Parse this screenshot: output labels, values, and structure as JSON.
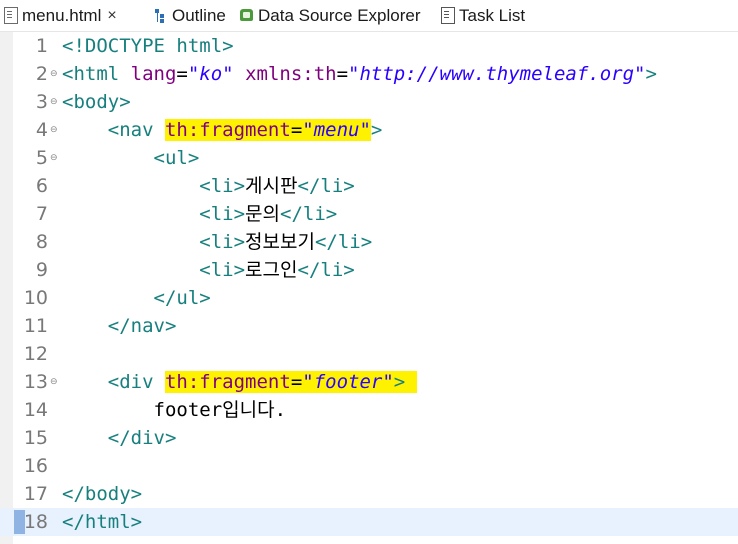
{
  "tabs": [
    {
      "label": "menu.html",
      "icon": "html-file-icon",
      "closable": true,
      "active": true
    },
    {
      "label": "Outline",
      "icon": "outline-icon"
    },
    {
      "label": "Data Source Explorer",
      "icon": "data-source-icon"
    },
    {
      "label": "Task List",
      "icon": "task-list-icon"
    }
  ],
  "close_glyph": "×",
  "editor": {
    "current_line": 18,
    "colors": {
      "tag": "#17807e",
      "attribute": "#7f007f",
      "string": "#2a00ff",
      "highlight": "#fff200",
      "current_line": "#e8f2fe"
    },
    "lines": [
      {
        "n": "1",
        "fold": "",
        "parts": [
          {
            "c": "tag",
            "t": "<!DOCTYPE html>"
          }
        ]
      },
      {
        "n": "2",
        "fold": "⊖",
        "parts": [
          {
            "c": "tag",
            "t": "<html "
          },
          {
            "c": "attr",
            "t": "lang"
          },
          {
            "c": "text",
            "t": "="
          },
          {
            "c": "str",
            "t": "\"ko\""
          },
          {
            "c": "text",
            "t": " "
          },
          {
            "c": "attr",
            "t": "xmlns:th"
          },
          {
            "c": "text",
            "t": "="
          },
          {
            "c": "str",
            "t": "\"http://www.thymeleaf.org\""
          },
          {
            "c": "tag",
            "t": ">"
          }
        ]
      },
      {
        "n": "3",
        "fold": "⊖",
        "parts": [
          {
            "c": "tag",
            "t": "<body>"
          }
        ]
      },
      {
        "n": "4",
        "fold": "⊖",
        "parts": [
          {
            "c": "text",
            "t": "    "
          },
          {
            "c": "tag",
            "t": "<nav"
          },
          {
            "c": "text",
            "t": " "
          },
          {
            "c": "attr",
            "t": "th:fragment",
            "hl": true
          },
          {
            "c": "text",
            "t": "=",
            "hl": true
          },
          {
            "c": "str",
            "t": "\"menu\"",
            "hl": true
          },
          {
            "c": "tag",
            "t": ">"
          }
        ]
      },
      {
        "n": "5",
        "fold": "⊖",
        "parts": [
          {
            "c": "text",
            "t": "        "
          },
          {
            "c": "tag",
            "t": "<ul>"
          }
        ]
      },
      {
        "n": "6",
        "fold": "",
        "parts": [
          {
            "c": "text",
            "t": "            "
          },
          {
            "c": "tag",
            "t": "<li>"
          },
          {
            "c": "text",
            "t": "게시판"
          },
          {
            "c": "tag",
            "t": "</li>"
          }
        ]
      },
      {
        "n": "7",
        "fold": "",
        "parts": [
          {
            "c": "text",
            "t": "            "
          },
          {
            "c": "tag",
            "t": "<li>"
          },
          {
            "c": "text",
            "t": "문의"
          },
          {
            "c": "tag",
            "t": "</li>"
          }
        ]
      },
      {
        "n": "8",
        "fold": "",
        "parts": [
          {
            "c": "text",
            "t": "            "
          },
          {
            "c": "tag",
            "t": "<li>"
          },
          {
            "c": "text",
            "t": "정보보기"
          },
          {
            "c": "tag",
            "t": "</li>"
          }
        ]
      },
      {
        "n": "9",
        "fold": "",
        "parts": [
          {
            "c": "text",
            "t": "            "
          },
          {
            "c": "tag",
            "t": "<li>"
          },
          {
            "c": "text",
            "t": "로그인"
          },
          {
            "c": "tag",
            "t": "</li>"
          }
        ]
      },
      {
        "n": "10",
        "fold": "",
        "parts": [
          {
            "c": "text",
            "t": "        "
          },
          {
            "c": "tag",
            "t": "</ul>"
          }
        ]
      },
      {
        "n": "11",
        "fold": "",
        "parts": [
          {
            "c": "text",
            "t": "    "
          },
          {
            "c": "tag",
            "t": "</nav>"
          }
        ]
      },
      {
        "n": "12",
        "fold": "",
        "parts": []
      },
      {
        "n": "13",
        "fold": "⊖",
        "parts": [
          {
            "c": "text",
            "t": "    "
          },
          {
            "c": "tag",
            "t": "<div"
          },
          {
            "c": "text",
            "t": " "
          },
          {
            "c": "attr",
            "t": "th:fragment",
            "hl": true
          },
          {
            "c": "text",
            "t": "=",
            "hl": true
          },
          {
            "c": "str",
            "t": "\"footer\"",
            "hl": true
          },
          {
            "c": "tag",
            "t": ">",
            "hl": true
          },
          {
            "c": "text",
            "t": " ",
            "hl": true
          }
        ]
      },
      {
        "n": "14",
        "fold": "",
        "parts": [
          {
            "c": "text",
            "t": "        footer입니다."
          }
        ]
      },
      {
        "n": "15",
        "fold": "",
        "parts": [
          {
            "c": "text",
            "t": "    "
          },
          {
            "c": "tag",
            "t": "</div>"
          }
        ]
      },
      {
        "n": "16",
        "fold": "",
        "parts": []
      },
      {
        "n": "17",
        "fold": "",
        "parts": [
          {
            "c": "tag",
            "t": "</body>"
          }
        ]
      },
      {
        "n": "18",
        "fold": "",
        "parts": [
          {
            "c": "tag",
            "t": "</html>"
          }
        ]
      }
    ]
  }
}
